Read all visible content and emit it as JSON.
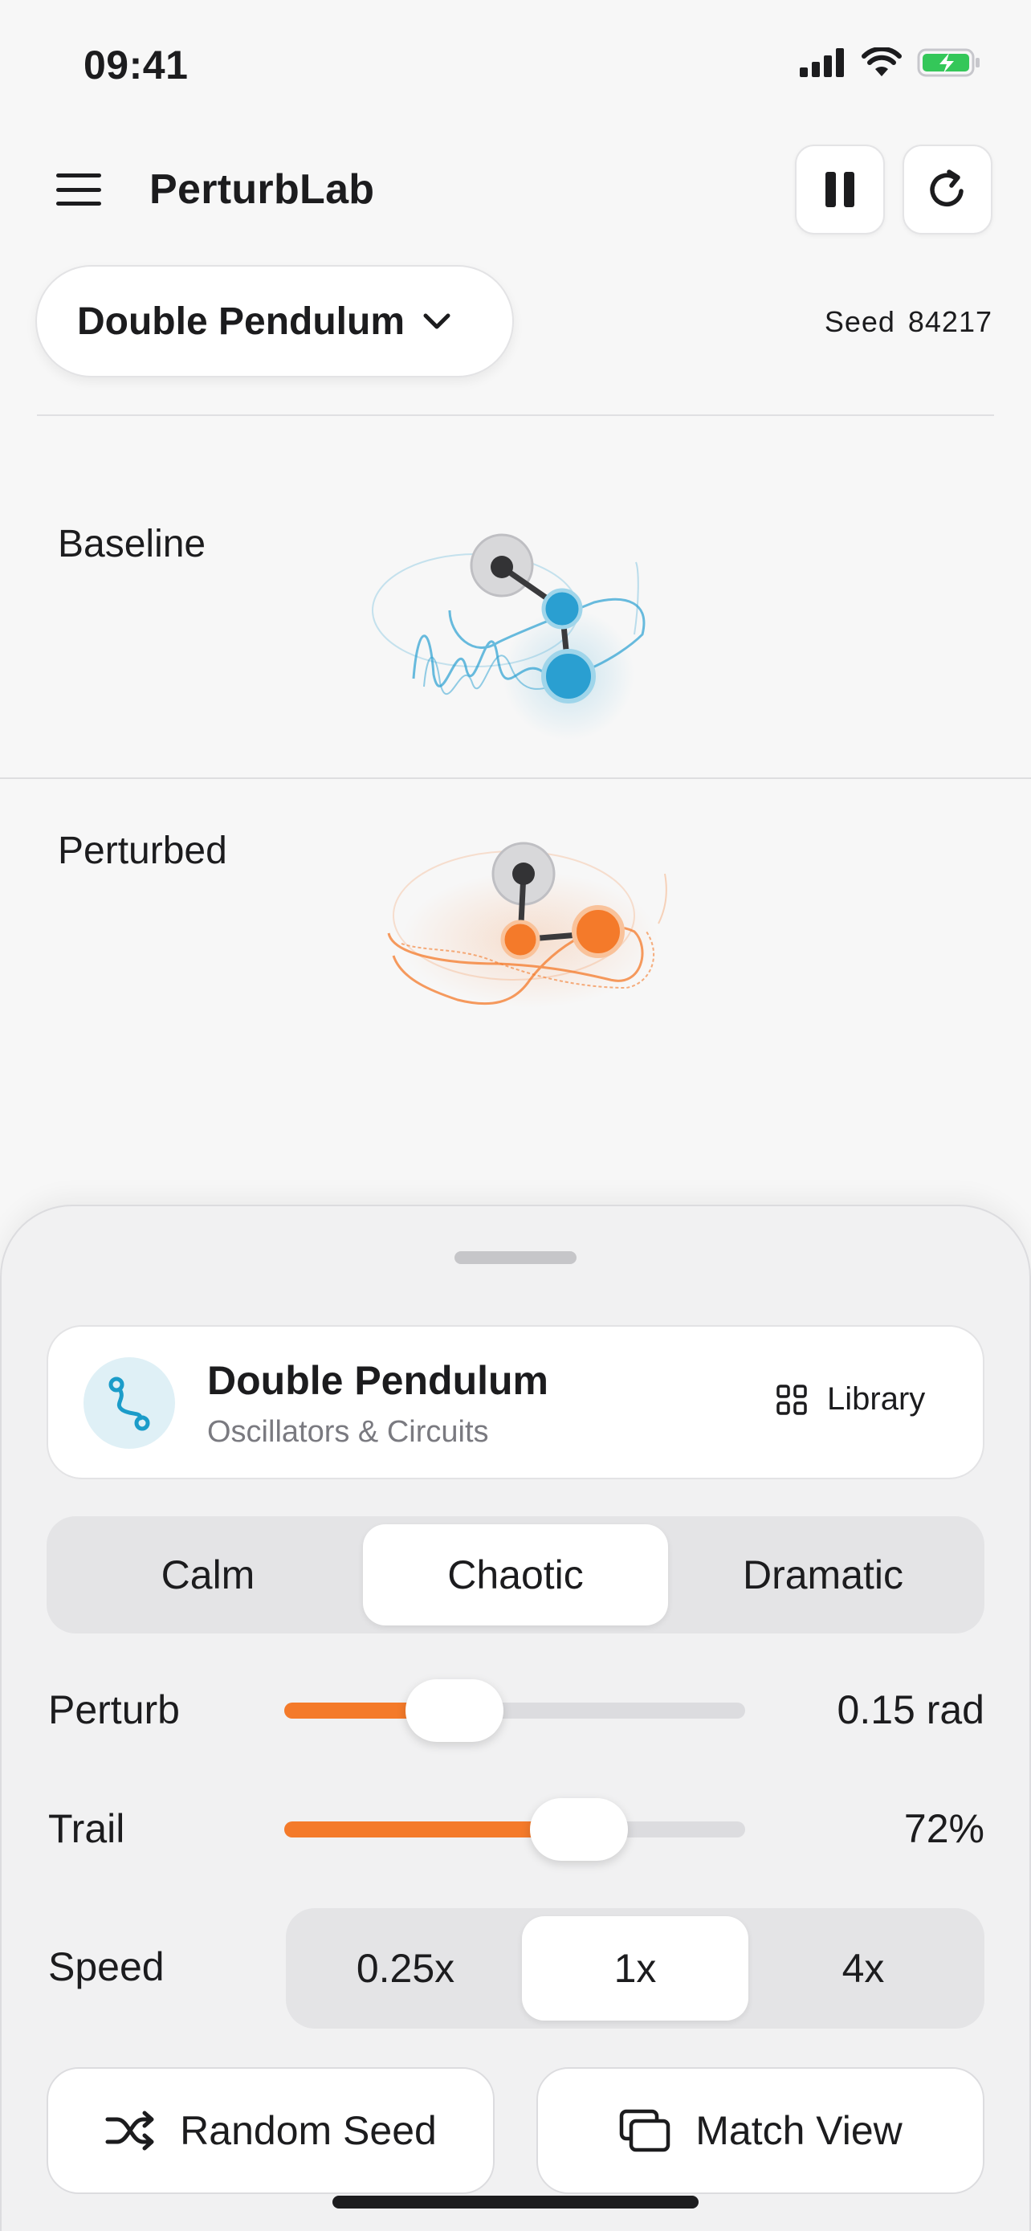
{
  "status_bar": {
    "time": "09:41"
  },
  "header": {
    "app_title": "PerturbLab"
  },
  "system_picker": {
    "label": "Double Pendulum"
  },
  "seed": {
    "label": "Seed",
    "value": "84217"
  },
  "panels": {
    "baseline_label": "Baseline",
    "perturbed_label": "Perturbed"
  },
  "system_card": {
    "title": "Double Pendulum",
    "subtitle": "Oscillators & Circuits",
    "library_label": "Library"
  },
  "presets": {
    "options": [
      "Calm",
      "Chaotic",
      "Dramatic"
    ],
    "selected": "Chaotic"
  },
  "perturb": {
    "label": "Perturb",
    "value_text": "0.15 rad",
    "fraction": 0.37
  },
  "trail": {
    "label": "Trail",
    "value_text": "72%",
    "fraction": 0.64
  },
  "speed": {
    "label": "Speed",
    "options": [
      "0.25x",
      "1x",
      "4x"
    ],
    "selected": "1x"
  },
  "actions": {
    "random_seed": "Random Seed",
    "match_view": "Match View"
  },
  "colors": {
    "baseline": "#2a9fd1",
    "perturbed": "#f47a2a",
    "accent": "#f47a2a",
    "battery": "#34c759"
  }
}
